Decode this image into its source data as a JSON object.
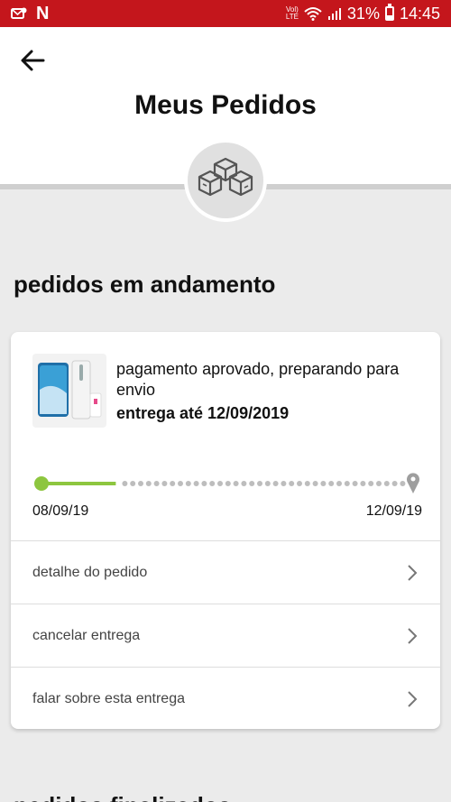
{
  "status_bar": {
    "left_icons": [
      "notification-icon",
      "netflix-icon"
    ],
    "netflix_glyph": "N",
    "network_line1": "Vol)",
    "network_line2": "LTE",
    "battery_percent": "31%",
    "battery_level": 0.31,
    "time": "14:45",
    "background_color": "#c4161c"
  },
  "header": {
    "back_icon": "arrow-left-icon",
    "title": "Meus Pedidos",
    "badge_icon": "boxes-icon"
  },
  "in_progress": {
    "section_title": "pedidos em andamento",
    "order": {
      "thumbnail_icon": "phone-product-image",
      "status_text": "pagamento aprovado, preparando para envio",
      "delivery_text": "entrega até 12/09/2019",
      "start_date": "08/09/19",
      "end_date": "12/09/19",
      "progress_fraction": 0.2,
      "progress_color": "#8dc63f",
      "end_icon": "location-pin-icon"
    },
    "actions": [
      {
        "label": "detalhe do pedido"
      },
      {
        "label": "cancelar entrega"
      },
      {
        "label": "falar sobre esta entrega"
      }
    ]
  },
  "finished": {
    "section_title": "pedidos finalizados"
  }
}
